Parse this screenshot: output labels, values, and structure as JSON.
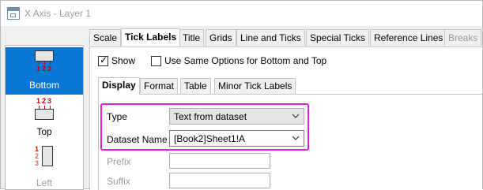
{
  "window": {
    "title": "X Axis - Layer 1"
  },
  "sidebar": {
    "items": [
      {
        "label": "Bottom",
        "selected": true
      },
      {
        "label": "Top",
        "selected": false
      },
      {
        "label": "Left",
        "selected": false
      }
    ],
    "tick_numbers": [
      "1",
      "2",
      "3"
    ]
  },
  "tabs": [
    {
      "label": "Scale",
      "active": false
    },
    {
      "label": "Tick Labels",
      "active": true
    },
    {
      "label": "Title",
      "active": false
    },
    {
      "label": "Grids",
      "active": false
    },
    {
      "label": "Line and Ticks",
      "active": false
    },
    {
      "label": "Special Ticks",
      "active": false
    },
    {
      "label": "Reference Lines",
      "active": false
    },
    {
      "label": "Breaks",
      "active": false,
      "disabled": true
    }
  ],
  "options": {
    "show_label": "Show",
    "show_checked": true,
    "same_options_label": "Use Same Options for Bottom and Top",
    "same_options_checked": false
  },
  "subtabs": [
    {
      "label": "Display",
      "active": true
    },
    {
      "label": "Format",
      "active": false
    },
    {
      "label": "Table",
      "active": false
    },
    {
      "label": "Minor Tick Labels",
      "active": false
    }
  ],
  "form": {
    "type_label": "Type",
    "type_value": "Text from dataset",
    "dataset_label": "Dataset Name",
    "dataset_value": "[Book2]Sheet1!A",
    "prefix_label": "Prefix",
    "suffix_label": "Suffix"
  },
  "colors": {
    "selection": "#0a76d6",
    "highlight_border": "#e020e0",
    "tick_number": "#cc0000"
  }
}
